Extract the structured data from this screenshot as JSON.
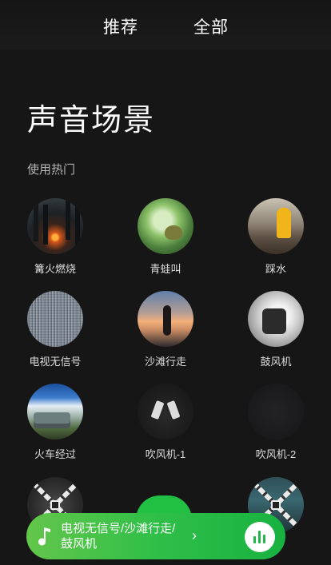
{
  "tabs": {
    "recommended": "推荐",
    "all": "全部"
  },
  "page_title": "声音场景",
  "section_title": "使用热门",
  "items": [
    {
      "label": "篝火燃烧",
      "icon": "bonfire-image"
    },
    {
      "label": "青蛙叫",
      "icon": "frog-image"
    },
    {
      "label": "踩水",
      "icon": "puddle-image"
    },
    {
      "label": "电视无信号",
      "icon": "tv-static-image"
    },
    {
      "label": "沙滩行走",
      "icon": "beach-walk-image"
    },
    {
      "label": "鼓风机",
      "icon": "blower-image"
    },
    {
      "label": "火车经过",
      "icon": "train-image"
    },
    {
      "label": "吹风机-1",
      "icon": "hairdryer-image"
    },
    {
      "label": "吹风机-2",
      "icon": "hairdryer-image"
    }
  ],
  "locked_items": [
    {
      "icon": "locked-image"
    },
    {
      "icon": "locked-image"
    }
  ],
  "player": {
    "now_playing": "电视无信号/沙滩行走/鼓风机",
    "chevron": "›",
    "accent_color": "#2fbf48"
  }
}
